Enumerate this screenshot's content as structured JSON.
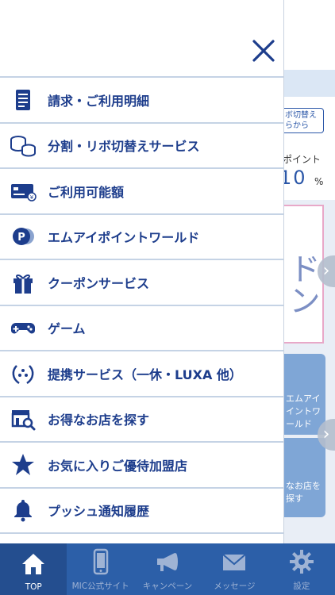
{
  "background": {
    "ribo_switch_label": "リボ切替え\nちらから",
    "point_label": "ポイント",
    "point_value": "10",
    "point_unit": "%",
    "banner_text": "ドン",
    "tile_1_text": "エムアイ\nイントワールド",
    "tile_2_text": "なお店を\n探す"
  },
  "drawer": {
    "items": [
      {
        "label": "請求・ご利用明細",
        "icon": "invoice-icon"
      },
      {
        "label": "分割・リボ切替えサービス",
        "icon": "coins-icon"
      },
      {
        "label": "ご利用可能額",
        "icon": "credit-card-icon"
      },
      {
        "label": "エムアイポイントワールド",
        "icon": "point-coin-icon"
      },
      {
        "label": "クーポンサービス",
        "icon": "gift-icon"
      },
      {
        "label": "ゲーム",
        "icon": "gamepad-icon"
      },
      {
        "label": "提携サービス（一休・LUXA 他）",
        "icon": "laurel-icon"
      },
      {
        "label": "お得なお店を探す",
        "icon": "store-search-icon"
      },
      {
        "label": "お気に入りご優待加盟店",
        "icon": "star-icon"
      },
      {
        "label": "プッシュ通知履歴",
        "icon": "bell-icon"
      }
    ]
  },
  "tabbar": {
    "tabs": [
      {
        "label": "TOP",
        "icon": "home-icon",
        "active": true
      },
      {
        "label": "MIC公式サイト",
        "icon": "smartphone-icon",
        "active": false
      },
      {
        "label": "キャンペーン",
        "icon": "megaphone-icon",
        "active": false
      },
      {
        "label": "メッセージ",
        "icon": "envelope-icon",
        "active": false
      },
      {
        "label": "設定",
        "icon": "gear-icon",
        "active": false
      }
    ]
  },
  "colors": {
    "accent": "#1d3d8c",
    "tabbar": "#2c5fa8",
    "divider": "#c5d3e5"
  }
}
